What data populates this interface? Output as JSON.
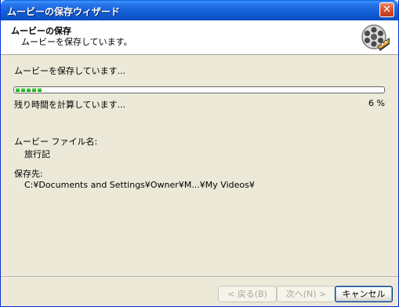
{
  "window": {
    "title": "ムービーの保存ウィザード"
  },
  "header": {
    "title": "ムービーの保存",
    "subtitle": "ムービーを保存しています。"
  },
  "content": {
    "status_label": "ムービーを保存しています...",
    "progress": {
      "fraction": 0.06,
      "segments": 5
    },
    "time_status": "残り時間を計算しています...",
    "percent_text": "6 %",
    "file_name_label": "ムービー ファイル名:",
    "file_name_value": "旅行記",
    "destination_label": "保存先:",
    "destination_value": "C:¥Documents and Settings¥Owner¥M...¥My Videos¥"
  },
  "buttons": {
    "back": "< 戻る(B)",
    "next": "次へ(N) >",
    "cancel": "キャンセル"
  },
  "colors": {
    "title_bar": "#1360d8",
    "dialog_bg": "#ece9d8",
    "progress_fill": "#2dbd2a"
  },
  "icons": {
    "header": "film-reel-icon",
    "close": "close-icon"
  }
}
